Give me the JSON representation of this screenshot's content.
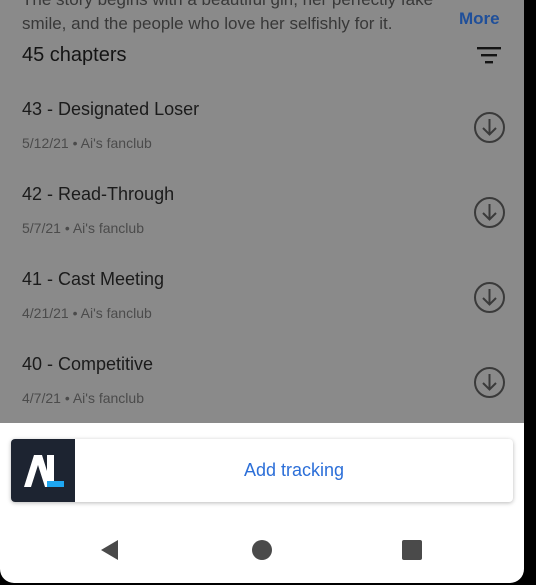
{
  "synopsis": {
    "line1": "The story begins with a beautiful girl, her perfectly fake",
    "line2": "smile, and the people who love her selfishly for it.",
    "more_label": "More"
  },
  "chapters_header": {
    "count_label": "45 chapters",
    "filter_icon": "filter-icon"
  },
  "chapters": [
    {
      "title": "43 - Designated Loser",
      "meta": "5/12/21 • Ai's fanclub"
    },
    {
      "title": "42 - Read-Through",
      "meta": "5/7/21 • Ai's fanclub"
    },
    {
      "title": "41 - Cast Meeting",
      "meta": "4/21/21 • Ai's fanclub"
    },
    {
      "title": "40 - Competitive",
      "meta": "4/7/21 • Ai's fanclub"
    }
  ],
  "tracking": {
    "logo_text": "AL",
    "add_label": "Add tracking",
    "accent_color": "#2c6fd8",
    "logo_bg": "#1d2431",
    "logo_accent": "#1ea7f2"
  },
  "navbar": {
    "back_icon": "back-triangle-icon",
    "home_icon": "home-circle-icon",
    "recents_icon": "recents-square-icon"
  }
}
